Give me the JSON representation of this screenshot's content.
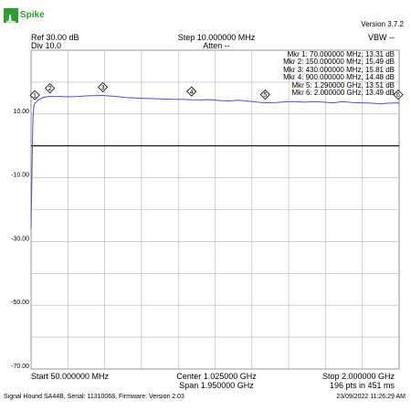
{
  "header": {
    "logo_text": "Spike",
    "version": "Version 3.7.2",
    "ref": "Ref 30.00 dB",
    "div": "Div 10.0",
    "step": "Step 10.000000 MHz",
    "atten": "Atten --",
    "vbw": "VBW --"
  },
  "footer": {
    "start": "Start 50.000000 MHz",
    "center": "Center 1.025000 GHz",
    "span": "Span 1.950000 GHz",
    "stop": "Stop 2.000000 GHz",
    "points": "196 pts in 451 ms",
    "device": "Signal Hound SA44B, Serial: 11310068, Firmware: Version 2.03",
    "timestamp": "23/09/2022 11:26:29 AM"
  },
  "colors": {
    "trace": "#5050d0",
    "grid": "#b4b4b4",
    "reference_line": "#000000",
    "brand": "#2e9e2e"
  },
  "chart_data": {
    "type": "line",
    "x_unit": "MHz",
    "y_unit": "dB",
    "xlim": [
      50,
      2000
    ],
    "ylim": [
      -70,
      30
    ],
    "x_divisions": 10,
    "y_divisions": 10,
    "y_tick_labels": [
      "10.00",
      "-10.00",
      "-30.00",
      "-50.00",
      "-70.00"
    ],
    "y_tick_values": [
      10,
      -10,
      -30,
      -50,
      -70
    ],
    "reference_level": 0,
    "grid": true,
    "series": [
      {
        "x": [
          50,
          55,
          60,
          65,
          70,
          90,
          110,
          130,
          150,
          200,
          250,
          300,
          350,
          430,
          500,
          550,
          600,
          650,
          700,
          750,
          800,
          850,
          900,
          950,
          1000,
          1050,
          1100,
          1150,
          1200,
          1250,
          1290,
          1350,
          1400,
          1450,
          1500,
          1550,
          1600,
          1650,
          1700,
          1750,
          1800,
          1850,
          1900,
          1950,
          2000
        ],
        "y": [
          -26,
          -8,
          9,
          12.5,
          13.31,
          14.4,
          15.1,
          15.4,
          15.49,
          15.5,
          15.4,
          15.5,
          15.7,
          15.81,
          15.5,
          15.2,
          15.0,
          14.9,
          14.8,
          14.7,
          14.6,
          14.6,
          14.48,
          14.4,
          14.5,
          14.2,
          14.1,
          14.3,
          14.0,
          13.7,
          13.51,
          13.6,
          13.8,
          13.9,
          13.7,
          13.9,
          13.7,
          13.5,
          13.9,
          13.6,
          13.5,
          13.4,
          13.2,
          13.4,
          13.49
        ]
      }
    ],
    "markers": [
      {
        "id": 1,
        "label": "1",
        "x": 70,
        "y": 13.31,
        "text": "Mkr 1: 70.000000 MHz, 13.31 dB"
      },
      {
        "id": 2,
        "label": "2",
        "x": 150,
        "y": 15.49,
        "text": "Mkr 2: 150.000000 MHz, 15.49 dB"
      },
      {
        "id": 3,
        "label": "3",
        "x": 430,
        "y": 15.81,
        "text": "Mkr 3: 430.000000 MHz, 15.81 dB"
      },
      {
        "id": 4,
        "label": "4",
        "x": 900,
        "y": 14.48,
        "text": "Mkr 4: 900.000000 MHz, 14.48 dB"
      },
      {
        "id": 5,
        "label": "5",
        "x": 1290,
        "y": 13.51,
        "text": "Mkr 5: 1.290000 GHz, 13.51 dB"
      },
      {
        "id": 6,
        "label": "6",
        "x": 2000,
        "y": 13.49,
        "text": "Mkr 6: 2.000000 GHz, 13.49 dB"
      }
    ]
  }
}
